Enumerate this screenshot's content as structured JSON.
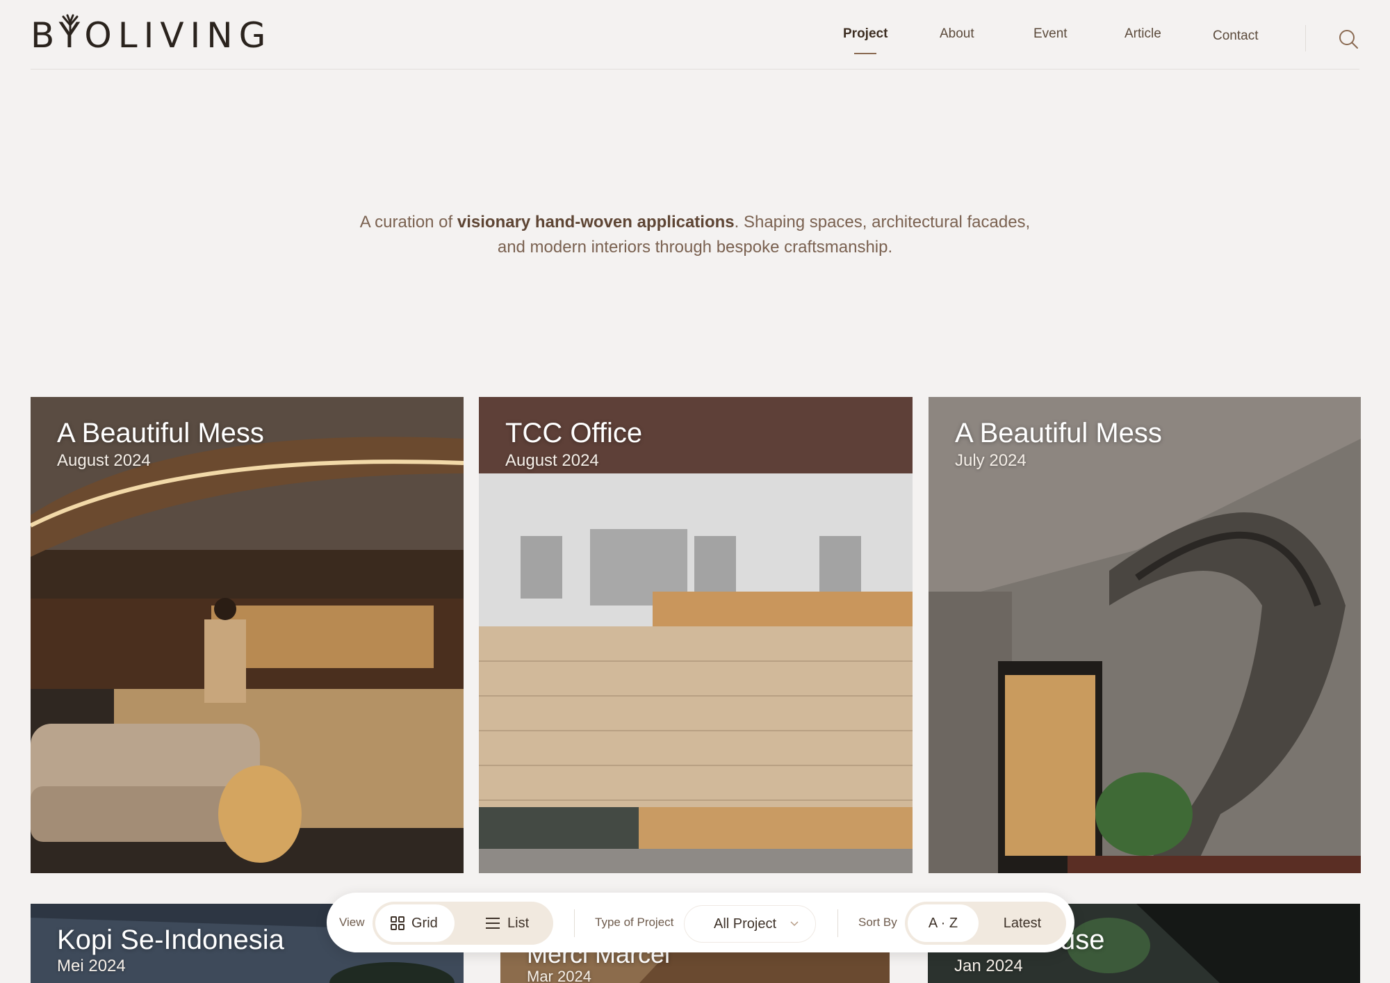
{
  "header": {
    "logo": "BYOLIVING",
    "nav": [
      {
        "label": "Project",
        "active": true
      },
      {
        "label": "About",
        "active": false
      },
      {
        "label": "Event",
        "active": false
      },
      {
        "label": "Article",
        "active": false
      },
      {
        "label": "Contact",
        "active": false
      }
    ],
    "search_icon": "search-icon"
  },
  "intro": {
    "prefix": "A curation of ",
    "highlight": "visionary hand-woven applications",
    "suffix": ". Shaping spaces, architectural facades, and modern interiors through bespoke craftsmanship."
  },
  "projects": [
    {
      "title": "A Beautiful Mess",
      "date": "August 2024"
    },
    {
      "title": "TCC Office",
      "date": "August 2024"
    },
    {
      "title": "A Beautiful Mess",
      "date": "July 2024"
    },
    {
      "title": "Kopi Se-Indonesia",
      "date": "Mei 2024"
    },
    {
      "title": "Merci Marcel",
      "date": "Mar 2024"
    },
    {
      "title": "use",
      "date": "Jan 2024"
    }
  ],
  "filter_bar": {
    "view_label": "View",
    "grid_label": "Grid",
    "list_label": "List",
    "type_label": "Type of Project",
    "type_value": "All Project",
    "sort_label": "Sort By",
    "sort_az": "A · Z",
    "sort_latest": "Latest"
  },
  "colors": {
    "accent": "#8a6a52",
    "background": "#f4f2f1"
  }
}
